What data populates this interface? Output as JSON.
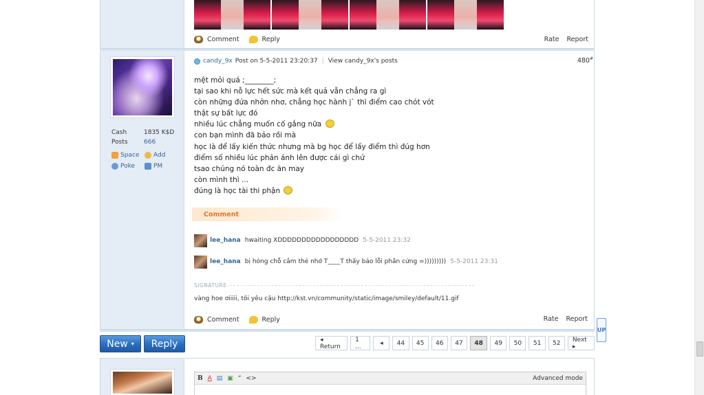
{
  "top_post": {
    "actions": {
      "comment": "Comment",
      "reply": "Reply"
    },
    "rate": "Rate",
    "report": "Report"
  },
  "post": {
    "author": "candy_9x",
    "meta": "Post on 5-5-2011 23:20:37",
    "view_posts": "View candy_9x's posts",
    "number": "480",
    "number_sup": "#",
    "stats": {
      "cash_label": "Cash",
      "cash_value": "1835 K$D",
      "posts_label": "Posts",
      "posts_value": "666"
    },
    "user_links": {
      "space": "Space",
      "add": "Add",
      "poke": "Poke",
      "pm": "PM"
    },
    "lines": [
      "mệt mỏi quá ;________;",
      "tại sao khi nỗ lực hết sức mà kết quả vẫn chẳng ra gì",
      "còn những đứa nhởn nhơ, chẳng học hành j` thì điểm cao chót vót",
      "thật sự bất lực đó",
      "nhiều lúc chẳng muốn cố gắng nữa",
      "con bạn mình đã bảo rồi mà",
      "học là để lấy kiến thức nhưng mà bg học để lấy điểm thì đúg hơn",
      "điểm số nhiều lúc phản ánh lên được cái gì chứ",
      "tsao chúng nó toàn đc ăn may",
      "còn mình thì ...",
      "đúng là học tài thi phận"
    ],
    "comment_tab": "Comment",
    "comments": [
      {
        "name": "lee_hana",
        "text": "hwaiting XDDDDDDDDDDDDDDDDD",
        "time": "5-5-2011 23:32"
      },
      {
        "name": "lee_hana",
        "text": "bị hỏng chỗ cắm thẻ nhớ T____T thấy bảo lỗi phần cứng =)))))))))",
        "time": "5-5-2011 23:31"
      }
    ],
    "signature_label": "SIGNATURE",
    "signature": "vàng hoe ơiiiii, tôi yêu cậu http://kst.vn/community/static/image/smiley/default/11.gif",
    "actions": {
      "comment": "Comment",
      "reply": "Reply"
    },
    "rate": "Rate",
    "report": "Report"
  },
  "toolbar": {
    "new_label": "New",
    "reply_label": "Reply",
    "pager": [
      "◂ Return",
      "1 ...",
      "◂",
      "44",
      "45",
      "46",
      "47",
      "48",
      "49",
      "50",
      "51",
      "52",
      "Next ▸"
    ],
    "current_page": "48"
  },
  "editor": {
    "tools": [
      "B",
      "A",
      "▤",
      "▣",
      "“",
      "<>"
    ],
    "advanced": "Advanced mode"
  },
  "side_button": "UP"
}
